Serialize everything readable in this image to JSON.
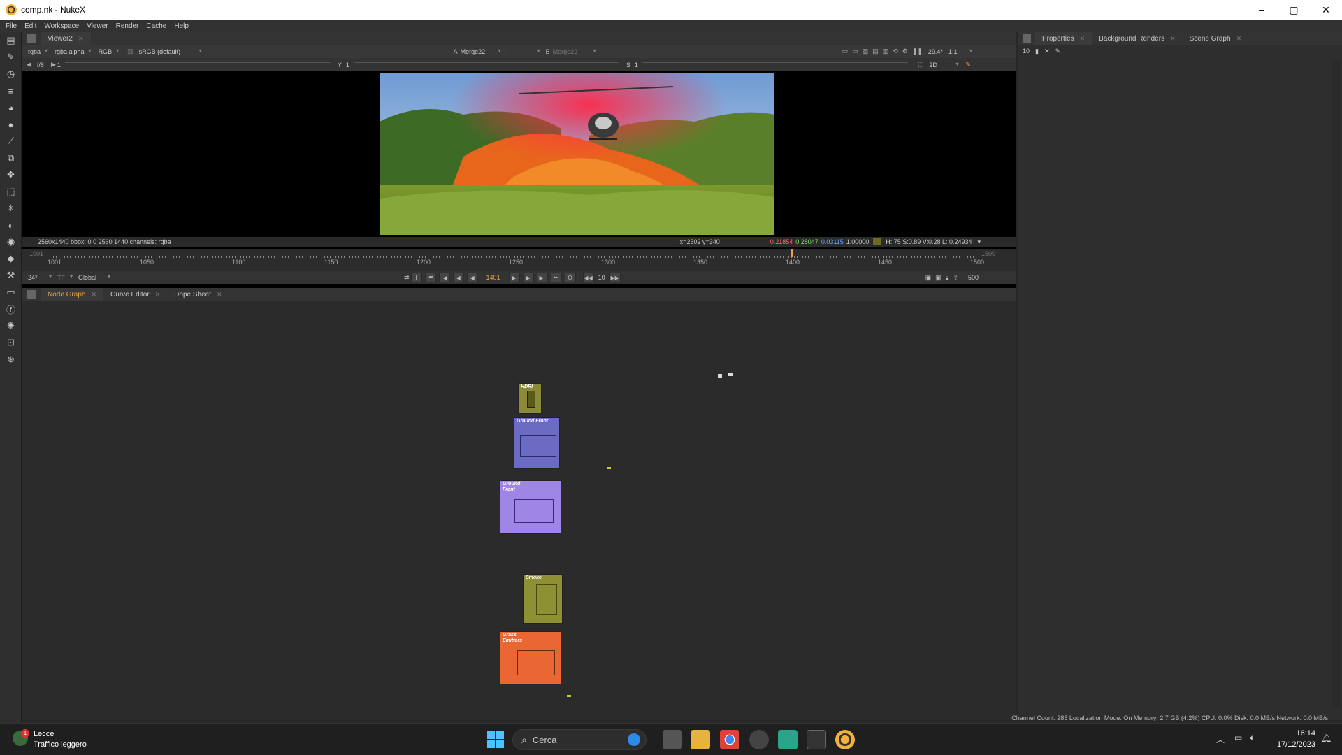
{
  "window": {
    "title": "comp.nk - NukeX",
    "controls": [
      "–",
      "▢",
      "✕"
    ]
  },
  "menu": [
    "File",
    "Edit",
    "Workspace",
    "Viewer",
    "Render",
    "Cache",
    "Help"
  ],
  "viewer": {
    "tab": "Viewer2",
    "channels": "rgba",
    "alpha": "rgba.alpha",
    "display_mode": "RGB",
    "colorspace": "sRGB (default)",
    "input_a": "Merge22",
    "input_a_label": "A",
    "input_a_dash": "-",
    "input_b": "Merge22",
    "input_b_label": "B",
    "fstop": "f/8",
    "frame_field": "1",
    "y_label": "Y",
    "y_value": "1",
    "s_label": "S",
    "s_value": "1",
    "fps_display": "29.4*",
    "zoom": "1:1",
    "view_mode": "2D",
    "info_left": "2560x1440  bbox: 0 0 2560 1440 channels: rgba",
    "cursor": "x=2502 y=340",
    "pixel_r": "0.21854",
    "pixel_g": "0.28047",
    "pixel_b": "0.03115",
    "pixel_a": "1.00000",
    "hsv": "H: 75 S:0.89 V:0.28  L: 0.24934"
  },
  "timeline": {
    "start": "1001",
    "end": "1500",
    "ticks": [
      "1001",
      "1050",
      "1100",
      "1150",
      "1200",
      "1250",
      "1300",
      "1350",
      "1400",
      "1450",
      "1500"
    ],
    "current_frame": "1401",
    "fps": "24*",
    "tf": "TF",
    "range_mode": "Global",
    "step": "10",
    "end_field": "500",
    "current_fraction": 0.8
  },
  "node_graph": {
    "tabs": [
      "Node Graph",
      "Curve Editor",
      "Dope Sheet"
    ],
    "nodes": [
      {
        "label": "HDRI",
        "color": "#8a8a3a"
      },
      {
        "label": "Ground Front",
        "color": "#6b6bc4"
      },
      {
        "label": "Ground Front",
        "color": "#9f85e6"
      },
      {
        "label": "Smoke",
        "color": "#8f8f33"
      },
      {
        "label": "Grass Emitters",
        "color": "#ea6632"
      }
    ]
  },
  "right_panel": {
    "tabs": [
      "Properties",
      "Background Renders",
      "Scene Graph"
    ],
    "counter": "10"
  },
  "status_bar": "Channel Count: 285  Localization Mode: On  Memory: 2.7 GB (4.2%)  CPU: 0.0%  Disk: 0.0 MB/s  Network: 0.0 MB/s",
  "taskbar": {
    "weather_city": "Lecce",
    "weather_status": "Traffico leggero",
    "weather_badge": "1",
    "search_placeholder": "Cerca",
    "time": "16:14",
    "date": "17/12/2023"
  }
}
